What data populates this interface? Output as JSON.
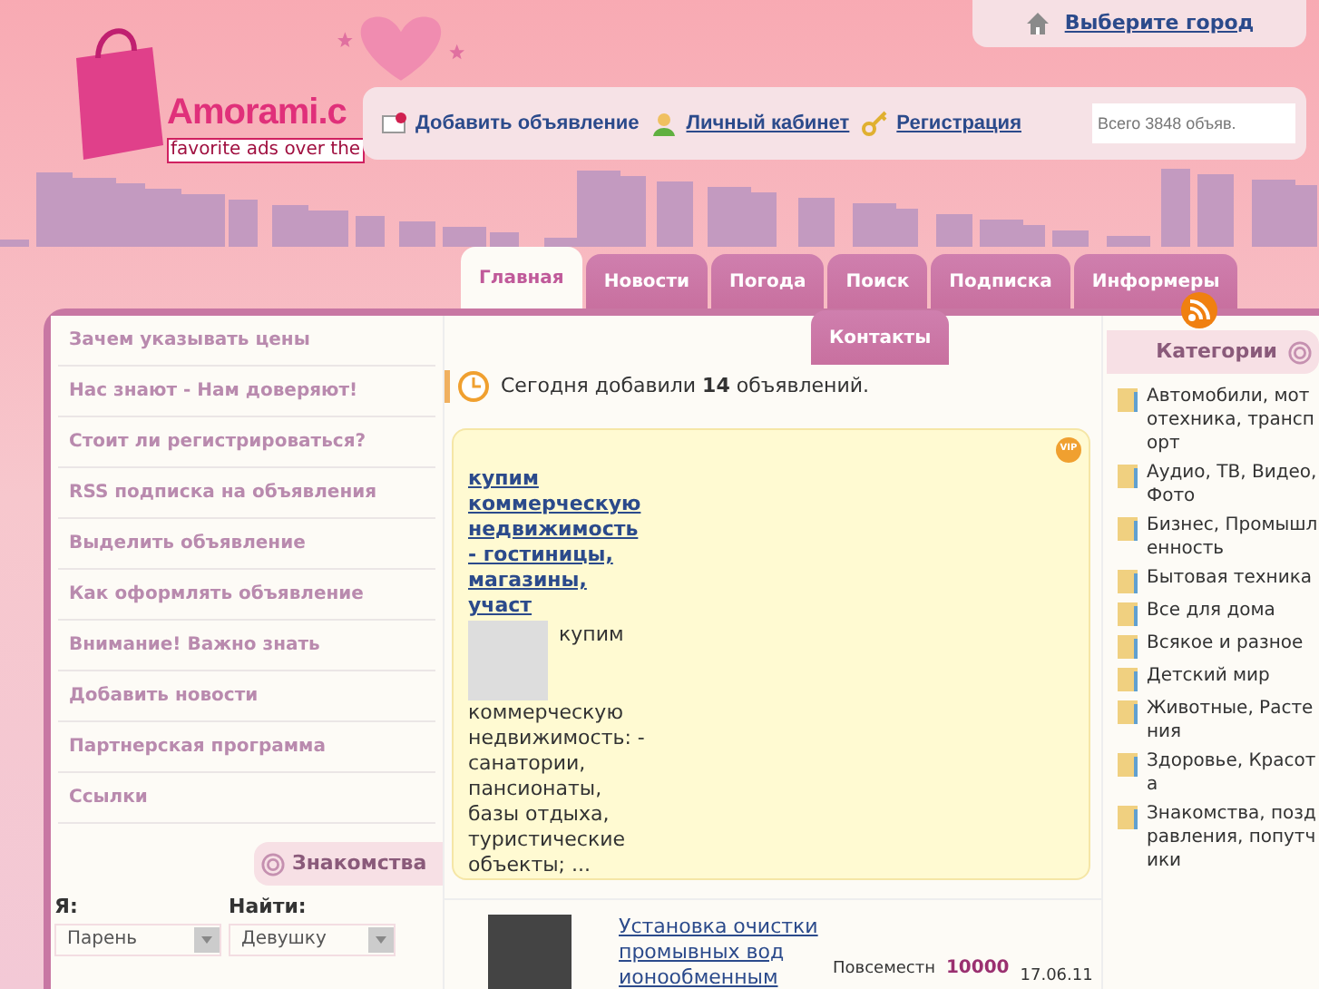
{
  "header": {
    "city_link": "Выберите город",
    "logo_text": "Amorami.c",
    "logo_tagline": "favorite ads over the",
    "links": [
      "Добавить объявление",
      "Личный кабинет",
      "Регистрация"
    ],
    "search": {
      "placeholder": "Всего 3848 объяв."
    }
  },
  "tabs": [
    {
      "label": "Главная",
      "selected": true
    },
    {
      "label": "Новости",
      "selected": false
    },
    {
      "label": "Погода",
      "selected": false
    },
    {
      "label": "Поиск",
      "selected": false
    },
    {
      "label": "Подписка",
      "selected": false
    },
    {
      "label": "Информеры",
      "selected": false
    },
    {
      "label": "Контакты",
      "selected": false
    }
  ],
  "sidebar": {
    "items": [
      "Зачем указывать цены",
      "Нас знают - Нам доверяют!",
      "Стоит ли регистрироваться?",
      "RSS подписка на объявления",
      "Выделить объявление",
      "Как оформлять объявление",
      "Внимание! Важно знать",
      "Добавить новости",
      "Партнерская программа",
      "Ссылки"
    ],
    "dating": {
      "title": "Знакомства",
      "fields": [
        {
          "label": "Я:",
          "value": "Парень"
        },
        {
          "label": "Найти:",
          "value": "Девушку"
        }
      ]
    }
  },
  "notice": "Сегодня добавили **14** объявлений.",
  "vip_ad": {
    "badge": "VIP",
    "title": "купим коммерческую недвижимость - гостиницы, магазины, участ",
    "text_before": "купим",
    "text": "коммерческую недвижимость: - санатории, пансионаты, базы отдыха, туристические объекты; ..."
  },
  "listing": {
    "title": "Установка очистки промывных вод ионообменным",
    "location": "Повсеместн",
    "price": "10000",
    "date": "17.06.11"
  },
  "categories": {
    "title": "Категории",
    "items": [
      "Автомобили, мототехника, транспорт",
      "Аудио, ТВ, Видео, Фото",
      "Бизнес, Промышленность",
      "Бытовая техника",
      "Все для дома",
      "Всякое и разное",
      "Детский мир",
      "Животные, Растения",
      "Здоровье, Красота",
      "Знакомства, поздравления, попутчики"
    ]
  }
}
